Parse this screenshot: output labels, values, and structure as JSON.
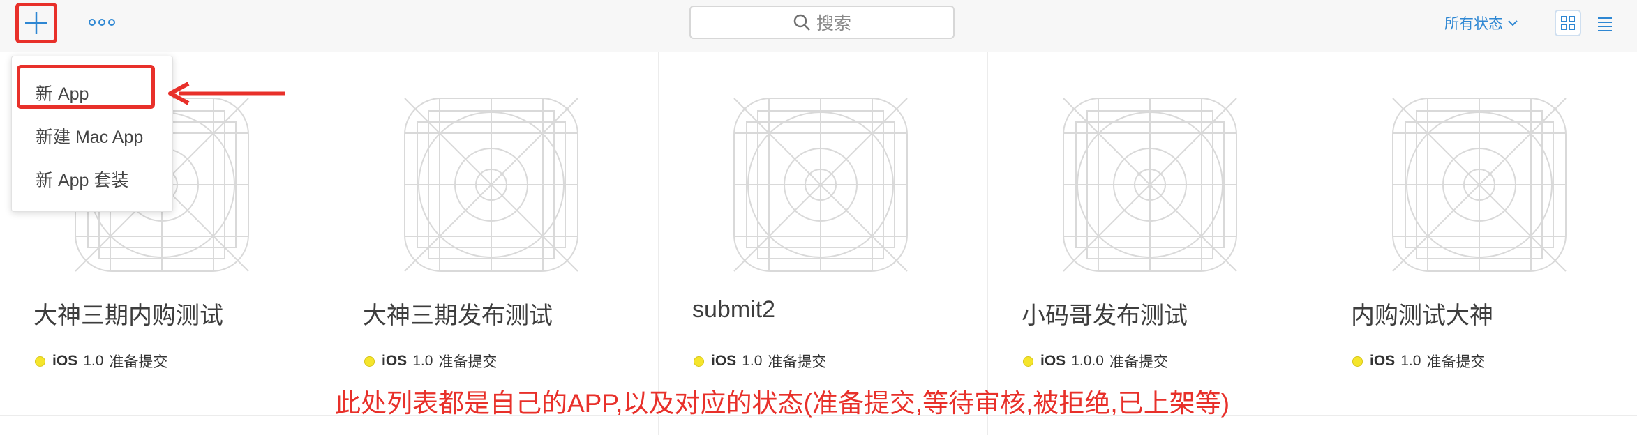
{
  "toolbar": {
    "search_placeholder": "搜索",
    "status_filter_label": "所有状态"
  },
  "dropdown": {
    "items": [
      {
        "label": "新 App"
      },
      {
        "label": "新建 Mac App"
      },
      {
        "label": "新 App 套装"
      }
    ]
  },
  "apps": [
    {
      "name": "大神三期内购测试",
      "platform": "iOS",
      "version": "1.0",
      "status": "准备提交"
    },
    {
      "name": "大神三期发布测试",
      "platform": "iOS",
      "version": "1.0",
      "status": "准备提交"
    },
    {
      "name": "submit2",
      "platform": "iOS",
      "version": "1.0",
      "status": "准备提交"
    },
    {
      "name": "小码哥发布测试",
      "platform": "iOS",
      "version": "1.0.0",
      "status": "准备提交"
    },
    {
      "name": "内购测试大神",
      "platform": "iOS",
      "version": "1.0",
      "status": "准备提交"
    }
  ],
  "annotation": "此处列表都是自己的APP,以及对应的状态(准备提交,等待审核,被拒绝,已上架等)",
  "colors": {
    "accent": "#2e87d3",
    "annotation_red": "#e8302a",
    "status_yellow": "#f5e52b"
  }
}
